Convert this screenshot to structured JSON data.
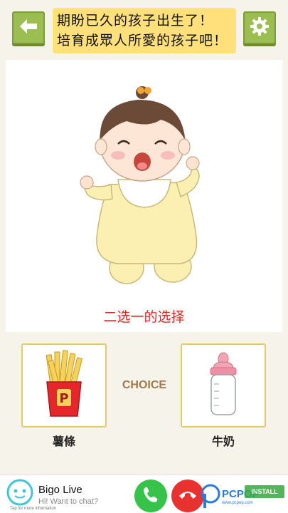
{
  "header": {
    "title_line1": "期盼已久的孩子出生了！",
    "title_line2": "培育成眾人所愛的孩子吧！"
  },
  "question": "二选一的选择",
  "choices": {
    "middle": "CHOICE",
    "left": {
      "label": "薯條",
      "icon": "french-fries-icon"
    },
    "right": {
      "label": "牛奶",
      "icon": "baby-bottle-icon"
    }
  },
  "ad": {
    "title": "Bigo Live",
    "subtitle": "Hi! Want to chat?",
    "info": "Tap for more information",
    "watermark": "PCPOP",
    "watermark_sub": "www.pcpop.com",
    "install": "INSTALL"
  },
  "colors": {
    "accent_green": "#9cbd52",
    "title_bg": "#ffe07a",
    "question_red": "#d9281f",
    "card_border": "#e8c96a",
    "choice_brown": "#a07a4c"
  }
}
